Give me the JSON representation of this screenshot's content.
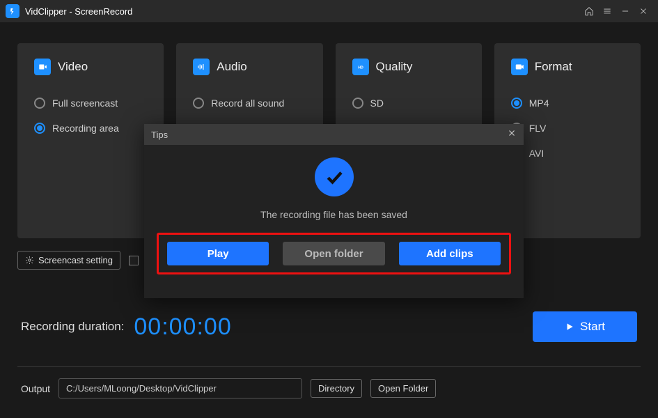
{
  "titlebar": {
    "title": "VidClipper - ScreenRecord"
  },
  "panels": {
    "video": {
      "label": "Video",
      "options": [
        {
          "label": "Full screencast",
          "selected": false
        },
        {
          "label": "Recording area",
          "selected": true
        }
      ]
    },
    "audio": {
      "label": "Audio",
      "options": [
        {
          "label": "Record all sound",
          "selected": false
        }
      ]
    },
    "quality": {
      "label": "Quality",
      "options": [
        {
          "label": "SD",
          "selected": false
        }
      ]
    },
    "format": {
      "label": "Format",
      "options": [
        {
          "label": "MP4",
          "selected": true
        },
        {
          "label": "FLV",
          "selected": false
        },
        {
          "label": "AVI",
          "selected": false
        }
      ]
    }
  },
  "toolbar": {
    "screencast_setting": "Screencast setting"
  },
  "duration": {
    "label": "Recording duration:",
    "value": "00:00:00"
  },
  "start_label": "Start",
  "output": {
    "label": "Output",
    "path": "C:/Users/MLoong/Desktop/VidClipper",
    "directory_btn": "Directory",
    "open_folder_btn": "Open Folder"
  },
  "modal": {
    "title": "Tips",
    "message": "The recording file has been saved",
    "play": "Play",
    "open_folder": "Open folder",
    "add_clips": "Add clips"
  }
}
